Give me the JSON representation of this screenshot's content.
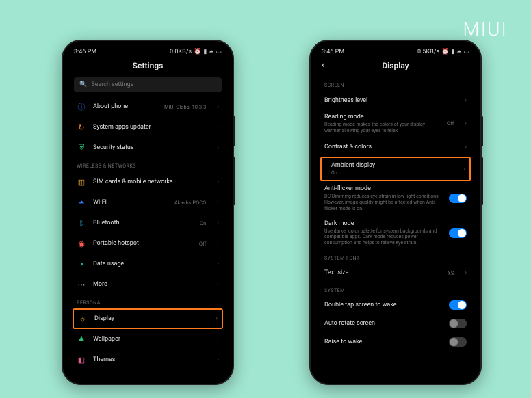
{
  "brand": "MIUI",
  "status": {
    "time": "3:46 PM",
    "net_left": "0.0KB/s",
    "net_right": "0.5KB/s"
  },
  "left": {
    "title": "Settings",
    "search_placeholder": "Search settings",
    "rows": {
      "about": {
        "label": "About phone",
        "meta": "MIUI Global 10.3.3"
      },
      "updater": {
        "label": "System apps updater"
      },
      "security": {
        "label": "Security status"
      }
    },
    "section_wireless": "WIRELESS & NETWORKS",
    "wireless": {
      "sim": {
        "label": "SIM cards & mobile networks"
      },
      "wifi": {
        "label": "Wi-Fi",
        "meta": "Akashs POCO"
      },
      "bluetooth": {
        "label": "Bluetooth",
        "meta": "On"
      },
      "hotspot": {
        "label": "Portable hotspot",
        "meta": "Off"
      },
      "data": {
        "label": "Data usage"
      },
      "more": {
        "label": "More"
      }
    },
    "section_personal": "PERSONAL",
    "personal": {
      "display": {
        "label": "Display"
      },
      "wallpaper": {
        "label": "Wallpaper"
      },
      "themes": {
        "label": "Themes"
      }
    }
  },
  "right": {
    "title": "Display",
    "section_screen": "SCREEN",
    "screen": {
      "brightness": {
        "label": "Brightness level"
      },
      "reading": {
        "label": "Reading mode",
        "sub": "Reading mode makes the colors of your display warmer allowing your eyes to relax",
        "meta": "Off"
      },
      "contrast": {
        "label": "Contrast & colors"
      },
      "ambient": {
        "label": "Ambient display",
        "sub": "On"
      },
      "antiflicker": {
        "label": "Anti-flicker mode",
        "sub": "DC Dimming reduces eye strain in low light conditions. However, image quality might be affected when Anti-flicker mode is on."
      },
      "dark": {
        "label": "Dark mode",
        "sub": "Use darker color palette for system backgrounds and compatible apps. Dark mode reduces power consumption and helps to relieve eye strain."
      }
    },
    "section_font": "SYSTEM FONT",
    "font": {
      "textsize": {
        "label": "Text size",
        "meta": "XS"
      }
    },
    "section_system": "SYSTEM",
    "system": {
      "doubletap": {
        "label": "Double tap screen to wake"
      },
      "autorotate": {
        "label": "Auto-rotate screen"
      },
      "raise": {
        "label": "Raise to wake"
      }
    }
  }
}
